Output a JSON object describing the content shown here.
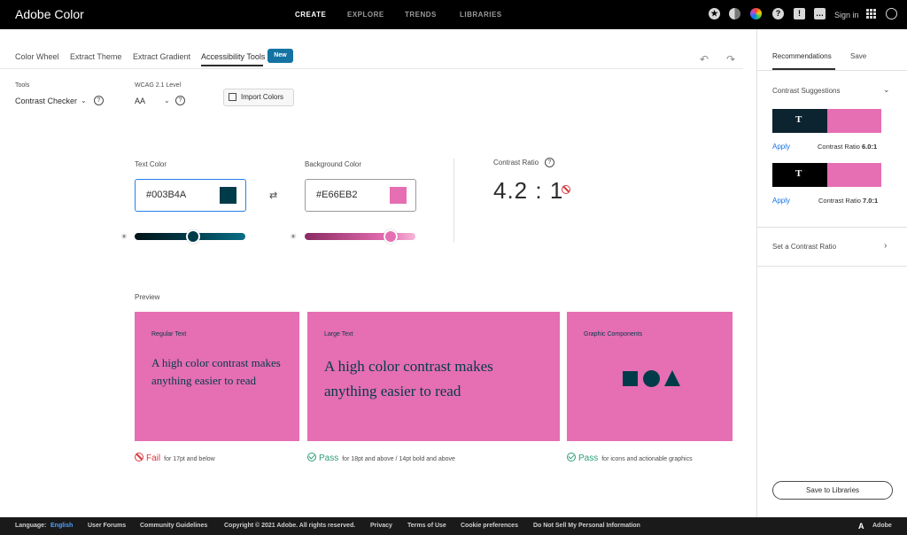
{
  "topbar": {
    "brand": "Adobe Color",
    "nav": [
      "CREATE",
      "EXPLORE",
      "TRENDS",
      "LIBRARIES"
    ],
    "active_nav": "CREATE",
    "sign_in": "Sign in"
  },
  "tabs": {
    "items": [
      "Color Wheel",
      "Extract Theme",
      "Extract Gradient",
      "Accessibility Tools"
    ],
    "active": "Accessibility Tools",
    "new_badge": "New"
  },
  "tools": {
    "tools_label": "Tools",
    "tool_value": "Contrast Checker",
    "wcag_label": "WCAG 2.1 Level",
    "wcag_value": "AA",
    "import_label": "Import Colors"
  },
  "colors": {
    "text_label": "Text Color",
    "text_hex": "#003B4A",
    "text_swatch": "#003b4a",
    "bg_label": "Background Color",
    "bg_hex": "#E66EB2",
    "bg_swatch": "#e66eb2",
    "text_brightness": 0.53,
    "bg_brightness": 0.78
  },
  "contrast": {
    "label": "Contrast Ratio",
    "value": "4.2 : 1"
  },
  "preview": {
    "title": "Preview",
    "cards": [
      {
        "title": "Regular Text",
        "sample": "A high color contrast makes anything easier to read"
      },
      {
        "title": "Large Text",
        "sample": "A high color contrast makes anything easier to read"
      },
      {
        "title": "Graphic Components",
        "sample": ""
      }
    ],
    "results": [
      {
        "status": "Fail",
        "note": "for 17pt and below"
      },
      {
        "status": "Pass",
        "note": "for 18pt and above / 14pt bold and above"
      },
      {
        "status": "Pass",
        "note": "for icons and actionable graphics"
      }
    ]
  },
  "panel": {
    "tabs": [
      "Recommendations",
      "Save"
    ],
    "suggestions_label": "Contrast Suggestions",
    "suggestions": [
      {
        "letter": "T",
        "text_color": "#0c2330",
        "apply": "Apply",
        "ratio_label": "Contrast Ratio",
        "ratio": "6.0:1"
      },
      {
        "letter": "T",
        "text_color": "#000000",
        "apply": "Apply",
        "ratio_label": "Contrast Ratio",
        "ratio": "7.0:1"
      }
    ],
    "set_ratio": "Set a Contrast Ratio",
    "save_button": "Save to Libraries"
  },
  "footer": {
    "language_label": "Language:",
    "language_value": "English",
    "links": [
      "User Forums",
      "Community Guidelines",
      "Copyright © 2021 Adobe. All rights reserved.",
      "Privacy",
      "Terms of Use",
      "Cookie preferences",
      "Do Not Sell My Personal Information"
    ],
    "adobe": "Adobe"
  }
}
